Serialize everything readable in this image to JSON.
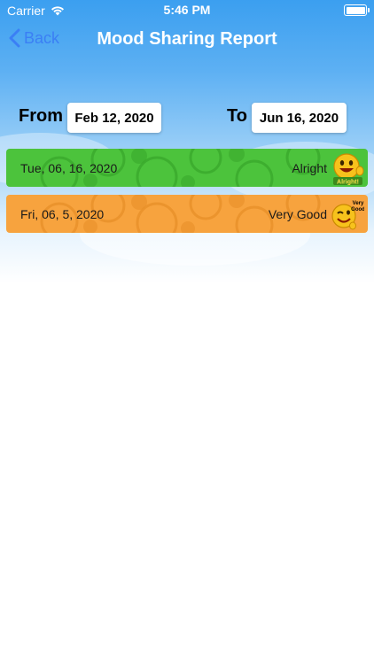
{
  "status": {
    "carrier": "Carrier",
    "time": "5:46 PM"
  },
  "nav": {
    "back_label": "Back",
    "title": "Mood Sharing Report"
  },
  "range": {
    "from_label": "From",
    "from_value": "Feb 12, 2020",
    "to_label": "To",
    "to_value": "Jun 16, 2020"
  },
  "entries": [
    {
      "date": "Tue, 06, 16, 2020",
      "mood": "Alright",
      "badge_text": "Alright!",
      "color": "#4cc33c"
    },
    {
      "date": "Fri, 06, 5, 2020",
      "mood": "Very Good",
      "badge_text": "Very Good",
      "color": "#f7a33e"
    }
  ],
  "colors": {
    "accent": "#3b7ff5",
    "header": "#3b9ff0"
  }
}
